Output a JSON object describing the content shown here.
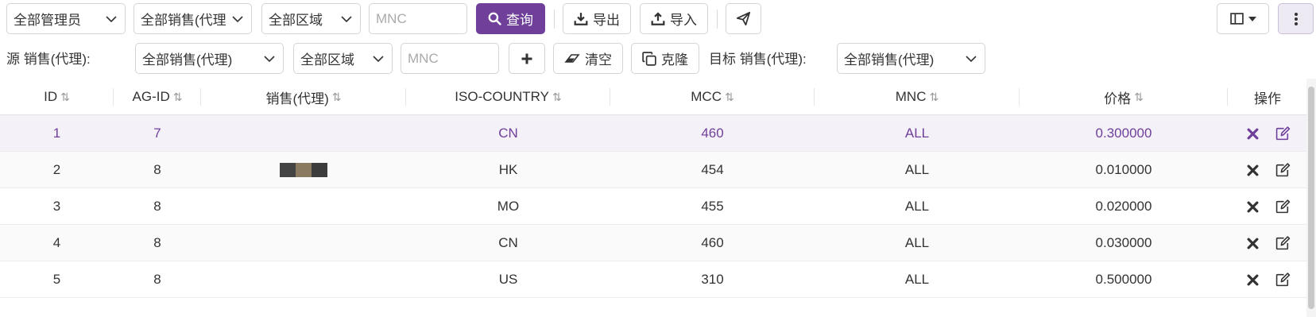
{
  "filters": {
    "admin_select": "全部管理员",
    "sales_select": "全部销售(代理",
    "region_select": "全部区域",
    "mnc_placeholder": "MNC",
    "query_label": "查询",
    "export_label": "导出",
    "import_label": "导入"
  },
  "clone_bar": {
    "source_label": "源 销售(代理):",
    "source_sales_select": "全部销售(代理)",
    "source_region_select": "全部区域",
    "mnc_placeholder": "MNC",
    "clear_label": "清空",
    "clone_label": "克隆",
    "target_label": "目标 销售(代理):",
    "target_sales_select": "全部销售(代理)"
  },
  "table": {
    "headers": {
      "id": "ID",
      "ag_id": "AG-ID",
      "sales": "销售(代理)",
      "iso_country": "ISO-COUNTRY",
      "mcc": "MCC",
      "mnc": "MNC",
      "price": "价格",
      "actions": "操作"
    },
    "sort_glyph": "⇅",
    "rows": [
      {
        "id": "1",
        "ag_id": "7",
        "sales": "",
        "iso": "CN",
        "mcc": "460",
        "mnc": "ALL",
        "price": "0.300000"
      },
      {
        "id": "2",
        "ag_id": "8",
        "sales": "",
        "iso": "HK",
        "mcc": "454",
        "mnc": "ALL",
        "price": "0.010000"
      },
      {
        "id": "3",
        "ag_id": "8",
        "sales": "",
        "iso": "MO",
        "mcc": "455",
        "mnc": "ALL",
        "price": "0.020000"
      },
      {
        "id": "4",
        "ag_id": "8",
        "sales": "",
        "iso": "CN",
        "mcc": "460",
        "mnc": "ALL",
        "price": "0.030000"
      },
      {
        "id": "5",
        "ag_id": "8",
        "sales": "",
        "iso": "US",
        "mcc": "310",
        "mnc": "ALL",
        "price": "0.500000"
      }
    ]
  },
  "colors": {
    "accent": "#6f3f9a",
    "selected_row": "#f4f1f9"
  },
  "icons": [
    "search-icon",
    "download-icon",
    "upload-icon",
    "send-icon",
    "columns-icon",
    "more-vertical-icon",
    "plus-icon",
    "eraser-icon",
    "copy-icon",
    "delete-icon",
    "edit-icon",
    "chevron-down-icon"
  ]
}
